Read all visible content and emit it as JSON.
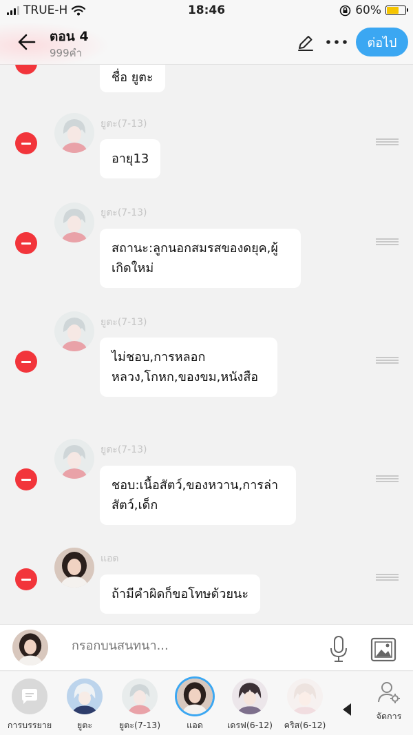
{
  "status_bar": {
    "carrier": "TRUE-H",
    "time": "18:46",
    "battery_percent": "60%",
    "battery_level": 0.6
  },
  "header": {
    "title": "ตอน 4",
    "subtitle": "999คำ",
    "next_label": "ต่อไป"
  },
  "top_partial_bubble": "ชื่อ ยูตะ",
  "messages": [
    {
      "sender": "ยูตะ(7-13)",
      "line1": "อายุ13",
      "line2": ""
    },
    {
      "sender": "ยูตะ(7-13)",
      "line1": "สถานะ:ลูกนอกสมรสของดยุค,ผู้",
      "line2": "เกิดใหม่"
    },
    {
      "sender": "ยูตะ(7-13)",
      "line1": "ไม่ชอบ,การหลอก",
      "line2": "หลวง,โกหก,ของขม,หนังสือ"
    },
    {
      "sender": "ยูตะ(7-13)",
      "line1": "ชอบ:เนื้อสัตว์,ของหวาน,การล่า",
      "line2": "สัตว์,เด็ก"
    },
    {
      "sender": "แอด",
      "line1": "ถ้ามีคำผิดก็ขอโทษด้วยนะ",
      "line2": ""
    }
  ],
  "input": {
    "placeholder": "กรอกบนสนทนา..."
  },
  "tray": {
    "characters": [
      {
        "label": "การบรรยาย"
      },
      {
        "label": "ยูตะ"
      },
      {
        "label": "ยูตะ(7-13)"
      },
      {
        "label": "แอด"
      },
      {
        "label": "เดรฟ(6-12)"
      },
      {
        "label": "คริส(6-12)"
      }
    ],
    "manage_label": "จัดการ"
  },
  "colors": {
    "accent": "#3ba7f2",
    "delete": "#f2353b",
    "battery": "#f5c400"
  }
}
